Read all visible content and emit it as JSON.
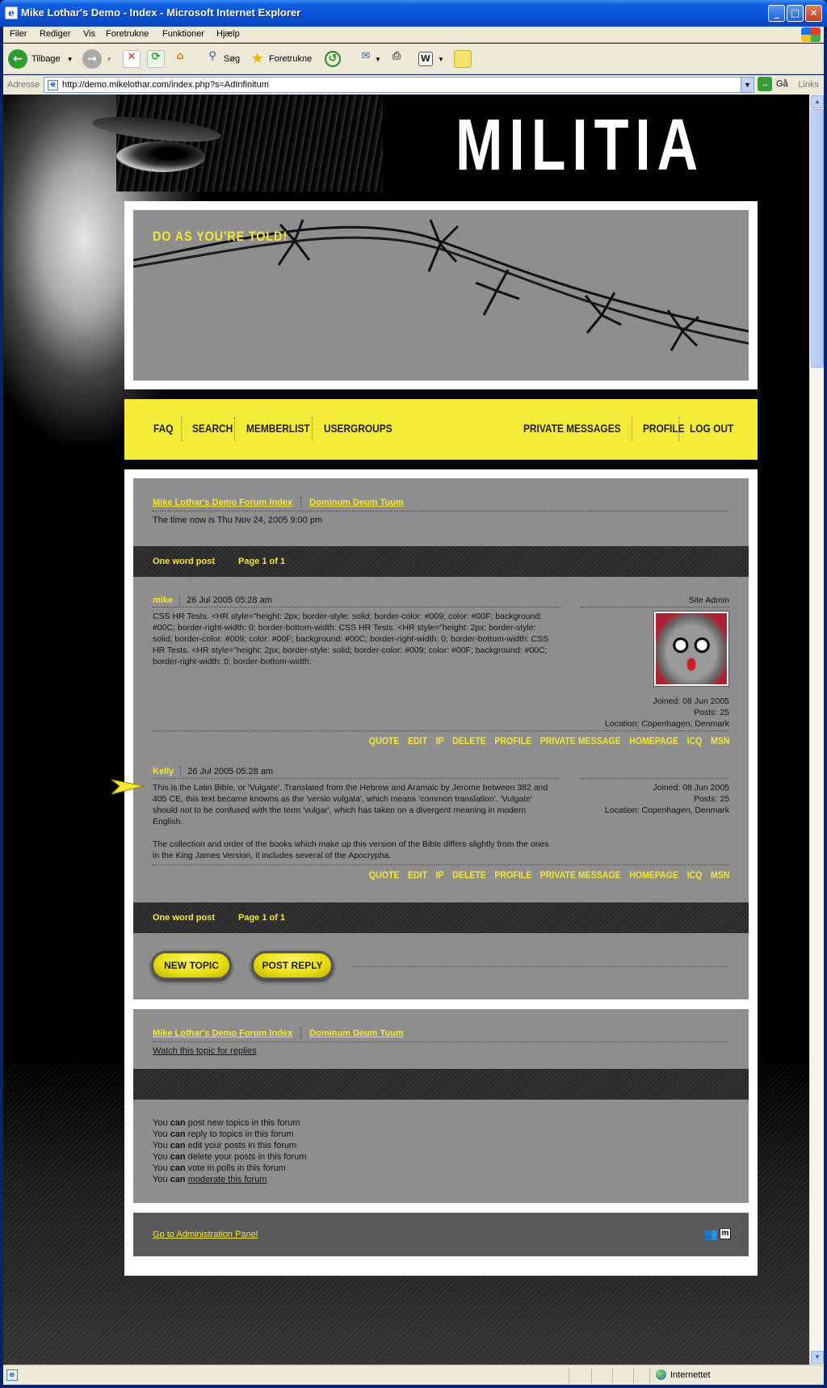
{
  "window": {
    "title": "Mike Lothar's Demo - Index - Microsoft Internet Explorer"
  },
  "menu": [
    "Filer",
    "Rediger",
    "Vis",
    "Foretrukne",
    "Funktioner",
    "Hjælp"
  ],
  "toolbar": {
    "back": "Tilbage",
    "search": "Søg",
    "favorites": "Foretrukne"
  },
  "address": {
    "label": "Adresse",
    "url": "http://demo.mikelothar.com/index.php?s=AdInfinitum",
    "go": "Gå",
    "links": "Links"
  },
  "status": {
    "zone": "Internettet"
  },
  "site": {
    "logo": "MILITIA",
    "slogan": "DO AS YOU'RE TOLD!",
    "nav_left": [
      "FAQ",
      "SEARCH",
      "MEMBERLIST",
      "USERGROUPS"
    ],
    "nav_right": [
      "PRIVATE MESSAGES",
      "PROFILE",
      "LOG OUT"
    ]
  },
  "forum": {
    "breadcrumb": [
      "Mike Lothar's Demo Forum Index",
      "Dominum Deum Tuum"
    ],
    "time": "The time now is Thu Nov 24, 2005 9:00 pm",
    "topic_title": "One word post",
    "page_info": "Page 1 of 1",
    "actions": [
      "QUOTE",
      "EDIT",
      "IP",
      "DELETE",
      "PROFILE",
      "PRIVATE MESSAGE",
      "HOMEPAGE",
      "ICQ",
      "MSN"
    ],
    "posts": [
      {
        "author": "mike",
        "date": "26 Jul 2005 05:28 am",
        "rank": "Site Admin",
        "body": "CSS HR Tests. <HR style=\"height: 2px; border-style: solid; border-color: #009; color: #00F; background: #00C; border-right-width: 0; border-bottom-width: CSS HR Tests. <HR style=\"height: 2px; border-style: solid; border-color: #009; color: #00F; background: #00C; border-right-width: 0; border-bottom-width: CSS HR Tests. <HR style=\"height: 2px; border-style: solid; border-color: #009; color: #00F; background: #00C; border-right-width: 0; border-bottom-width:",
        "joined": "Joined: 08 Jun 2005",
        "posts": "Posts: 25",
        "location": "Location: Copenhagen, Denmark"
      },
      {
        "author": "Kelly",
        "date": "26 Jul 2005 05:28 am",
        "body": "This is the Latin Bible, or 'Vulgate'. Translated from the Hebrew and Aramaic by Jerome between 382 and 405 CE, this text became knowns as the 'versio vulgata', which means 'common translation'. 'Vulgate' should not to be confused with the term 'vulgar', which has taken on a divergent meaning in modern English.",
        "body2": "The collection and order of the books which make up this version of the Bible differs slightly from the ones in the King James Version, it includes several of the Apocrypha.",
        "joined": "Joined: 08 Jun 2005",
        "posts": "Posts: 25",
        "location": "Location: Copenhagen, Denmark"
      }
    ],
    "new_topic": "NEW TOPIC",
    "post_reply": "POST REPLY",
    "watch": "Watch this topic for replies",
    "permissions": [
      {
        "pre": "You ",
        "b": "can",
        "post": " post new topics in this forum"
      },
      {
        "pre": "You ",
        "b": "can",
        "post": " reply to topics in this forum"
      },
      {
        "pre": "You ",
        "b": "can",
        "post": " edit your posts in this forum"
      },
      {
        "pre": "You ",
        "b": "can",
        "post": " delete your posts in this forum"
      },
      {
        "pre": "You ",
        "b": "can",
        "post": " vote in polls in this forum"
      },
      {
        "pre": "You ",
        "b": "can",
        "post": " "
      }
    ],
    "moderate": "moderate this forum",
    "admin_link": "Go to Administration Panel",
    "footer_icon_m": "m"
  }
}
